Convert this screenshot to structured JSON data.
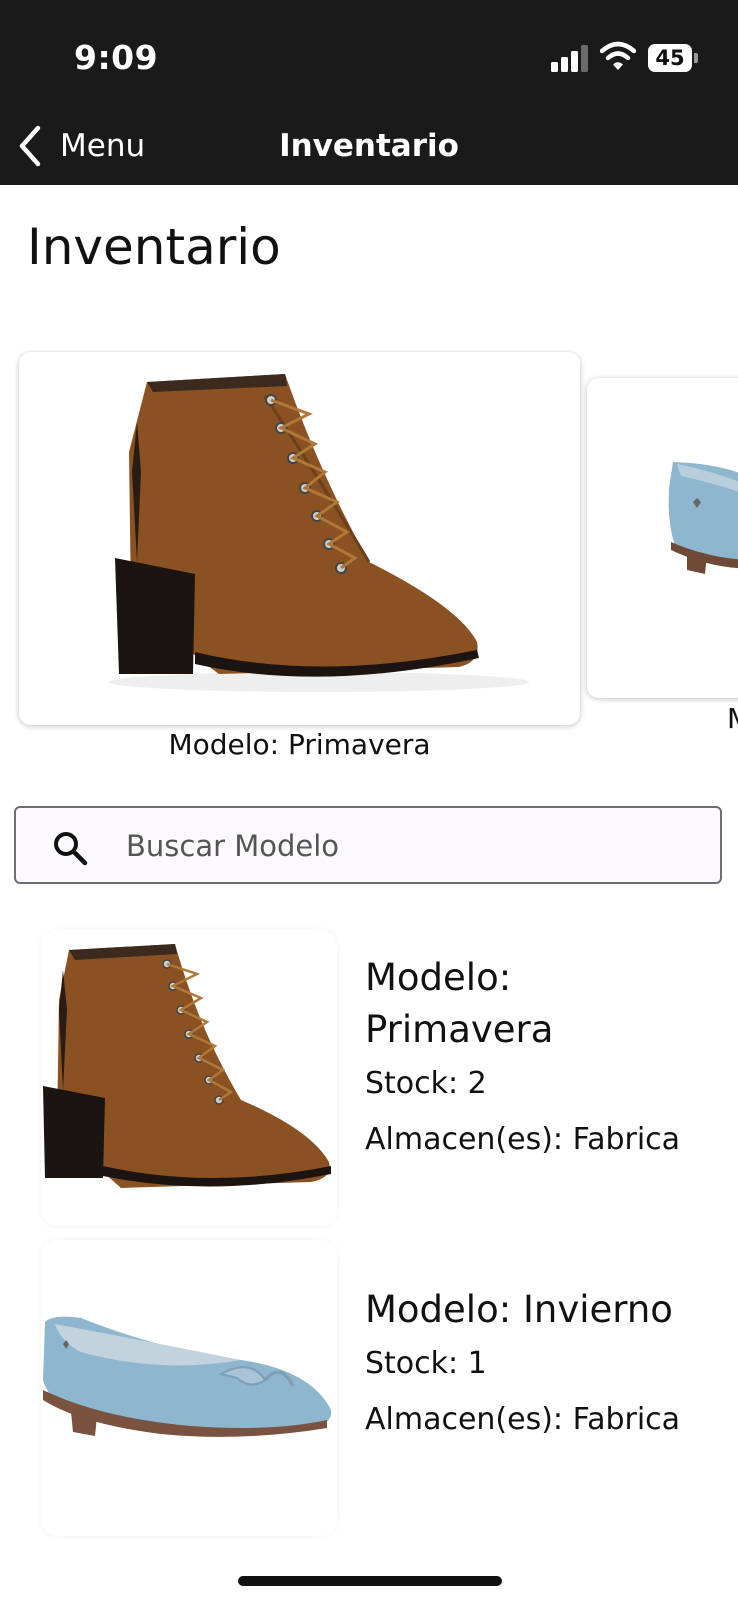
{
  "status_bar": {
    "time": "9:09",
    "battery": "45"
  },
  "nav": {
    "back_label": "Menu",
    "title": "Inventario"
  },
  "page": {
    "title": "Inventario"
  },
  "carousel": {
    "items": [
      {
        "label": "Modelo: Primavera"
      },
      {
        "label": "M"
      }
    ]
  },
  "search": {
    "placeholder": "Buscar Modelo",
    "value": ""
  },
  "list": {
    "items": [
      {
        "model_line1": "Modelo:",
        "model_line2": "Primavera",
        "stock": "Stock: 2",
        "warehouse": "Almacen(es): Fabrica"
      },
      {
        "model_line1": "Modelo: Invierno",
        "stock": "Stock: 1",
        "warehouse": "Almacen(es): Fabrica"
      }
    ]
  },
  "colors": {
    "bar_background": "#1a1a1a",
    "boot_brown": "#8a5222",
    "flat_blue": "#8fb6cf"
  }
}
